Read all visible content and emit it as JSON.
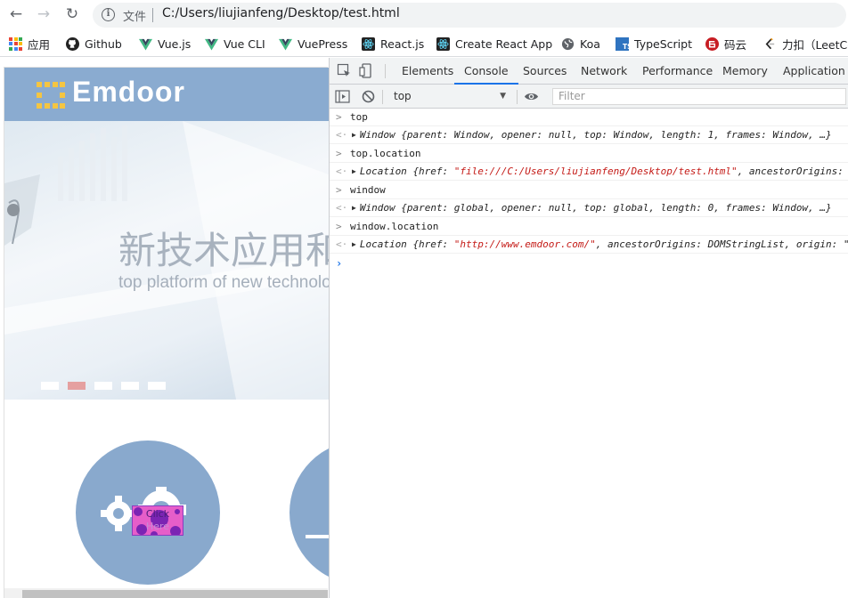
{
  "browser": {
    "file_label": "文件",
    "url": "C:/Users/liujianfeng/Desktop/test.html",
    "bookmarks": [
      {
        "label": "应用",
        "icon": "apps-grid-icon"
      },
      {
        "label": "Github",
        "icon": "github-icon"
      },
      {
        "label": "Vue.js",
        "icon": "vue-icon"
      },
      {
        "label": "Vue CLI",
        "icon": "vue-icon"
      },
      {
        "label": "VuePress",
        "icon": "vue-icon"
      },
      {
        "label": "React.js",
        "icon": "react-icon"
      },
      {
        "label": "Create React App",
        "icon": "react-icon"
      },
      {
        "label": "Koa",
        "icon": "globe-icon"
      },
      {
        "label": "TypeScript",
        "icon": "typescript-icon"
      },
      {
        "label": "码云",
        "icon": "gitee-icon"
      },
      {
        "label": "力扣（LeetCo",
        "icon": "leetcode-icon"
      }
    ]
  },
  "site": {
    "logo_text": "Emdoor",
    "banner_cn": "新技术应用和产",
    "banner_en": "top platform of new technolo",
    "click_label_1": "Click",
    "click_label_2": "Here",
    "colors": {
      "logo_bar": "#8aabd0",
      "circle": "#89a9cd",
      "active_dot": "#e5a0a0",
      "click_button": "#e65ec9"
    }
  },
  "devtools": {
    "tabs": [
      "Elements",
      "Console",
      "Sources",
      "Network",
      "Performance",
      "Memory",
      "Application"
    ],
    "active_tab": "Console",
    "context": "top",
    "filter_placeholder": "Filter",
    "console": [
      {
        "kind": "input",
        "text": "top"
      },
      {
        "kind": "output",
        "obj": "Window",
        "body": "{parent: Window, opener: null, top: Window, length: 1, frames: Window, …}"
      },
      {
        "kind": "input",
        "text": "top.location"
      },
      {
        "kind": "output",
        "obj": "Location",
        "body_pre": "{href: ",
        "body_str": "\"file:///C:/Users/liujianfeng/Desktop/test.html\"",
        "body_post": ", ancestorOrigins: "
      },
      {
        "kind": "input",
        "text": "window"
      },
      {
        "kind": "output",
        "obj": "Window",
        "body": "{parent: global, opener: null, top: global, length: 0, frames: Window, …}"
      },
      {
        "kind": "input",
        "text": "window.location"
      },
      {
        "kind": "output",
        "obj": "Location",
        "body_pre": "{href: ",
        "body_str": "\"http://www.emdoor.com/\"",
        "body_post": ", ancestorOrigins: DOMStringList, origin: \""
      }
    ]
  }
}
